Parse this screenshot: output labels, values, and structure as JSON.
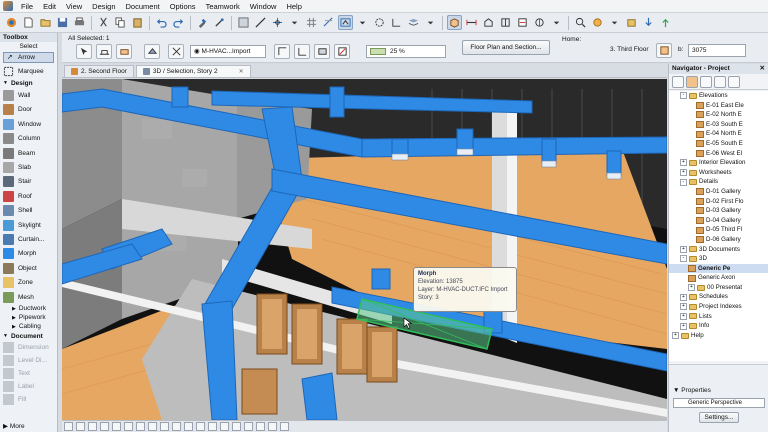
{
  "menu": [
    "File",
    "Edit",
    "View",
    "Design",
    "Document",
    "Options",
    "Teamwork",
    "Window",
    "Help"
  ],
  "info_box": {
    "all_selected_label": "All Selected: 1",
    "layer_value": "M-HVAC...Import",
    "zoom_value": "25 %",
    "floor_plan_button": "Floor Plan and Section...",
    "home_label": "Home:",
    "home_story": "3. Third Floor",
    "b_label": "b:",
    "b_value": "3075"
  },
  "toolbox": {
    "title": "Toolbox",
    "select_label": "Select",
    "arrow_label": "Arrow",
    "marquee_label": "Marquee",
    "design_group": "Design",
    "design_tools": [
      "Wall",
      "Door",
      "Window",
      "Column",
      "Beam",
      "Slab",
      "Stair",
      "Roof",
      "Shell",
      "Skylight",
      "Curtain...",
      "Morph",
      "Object",
      "Zone",
      "Mesh"
    ],
    "design_subgroups": [
      "Ductwork",
      "Pipework",
      "Cabling"
    ],
    "document_group": "Document",
    "document_tools": [
      "Dimension",
      "Level Di...",
      "Text",
      "Label",
      "Fill"
    ],
    "more_label": "More"
  },
  "tabs": [
    {
      "label": "2. Second Floor",
      "active": false
    },
    {
      "label": "3D / Selection, Story 2",
      "active": true
    }
  ],
  "tooltip": {
    "title": "Morph",
    "elevation": "Elevation: 13875",
    "layer": "Layer: M-HVAC-DUCT.IFC Import",
    "story": "Story: 3"
  },
  "navigator": {
    "title": "Navigator - Project",
    "tree": [
      {
        "label": "Elevations",
        "level": 1,
        "type": "folder",
        "expander": "-"
      },
      {
        "label": "E-01 East Ele",
        "level": 3,
        "type": "view"
      },
      {
        "label": "E-02 North E",
        "level": 3,
        "type": "view"
      },
      {
        "label": "E-03 South E",
        "level": 3,
        "type": "view"
      },
      {
        "label": "E-04 North E",
        "level": 3,
        "type": "view"
      },
      {
        "label": "E-05 South E",
        "level": 3,
        "type": "view"
      },
      {
        "label": "E-06 West El",
        "level": 3,
        "type": "view"
      },
      {
        "label": "Interior Elevation",
        "level": 1,
        "type": "folder",
        "expander": "+"
      },
      {
        "label": "Worksheets",
        "level": 1,
        "type": "folder",
        "expander": "+"
      },
      {
        "label": "Details",
        "level": 1,
        "type": "folder",
        "expander": "-"
      },
      {
        "label": "D-01 Gallery",
        "level": 3,
        "type": "view"
      },
      {
        "label": "D-02 First Flo",
        "level": 3,
        "type": "view"
      },
      {
        "label": "D-03 Gallery",
        "level": 3,
        "type": "view"
      },
      {
        "label": "D-04 Gallery",
        "level": 3,
        "type": "view"
      },
      {
        "label": "D-05 Third Fl",
        "level": 3,
        "type": "view"
      },
      {
        "label": "D-06 Gallery",
        "level": 3,
        "type": "view"
      },
      {
        "label": "3D Documents",
        "level": 1,
        "type": "folder",
        "expander": "+"
      },
      {
        "label": "3D",
        "level": 1,
        "type": "folder",
        "expander": "-"
      },
      {
        "label": "Generic Pe",
        "level": 2,
        "type": "view",
        "selected": true
      },
      {
        "label": "Generic Axon",
        "level": 2,
        "type": "view"
      },
      {
        "label": "00 Presentat",
        "level": 2,
        "type": "folder",
        "expander": "+"
      },
      {
        "label": "Schedules",
        "level": 1,
        "type": "folder",
        "expander": "+"
      },
      {
        "label": "Project Indexes",
        "level": 1,
        "type": "folder",
        "expander": "+"
      },
      {
        "label": "Lists",
        "level": 1,
        "type": "folder",
        "expander": "+"
      },
      {
        "label": "Info",
        "level": 1,
        "type": "folder",
        "expander": "+"
      },
      {
        "label": "Help",
        "level": 0,
        "type": "folder",
        "expander": "+"
      }
    ],
    "properties_label": "Properties",
    "properties_value": "Generic Perspective",
    "settings_button": "Settings..."
  },
  "colors": {
    "duct": "#2f8ae6",
    "floor": "#e6a763",
    "wall": "#9b9b9b",
    "selection": "#2fbf5a"
  }
}
